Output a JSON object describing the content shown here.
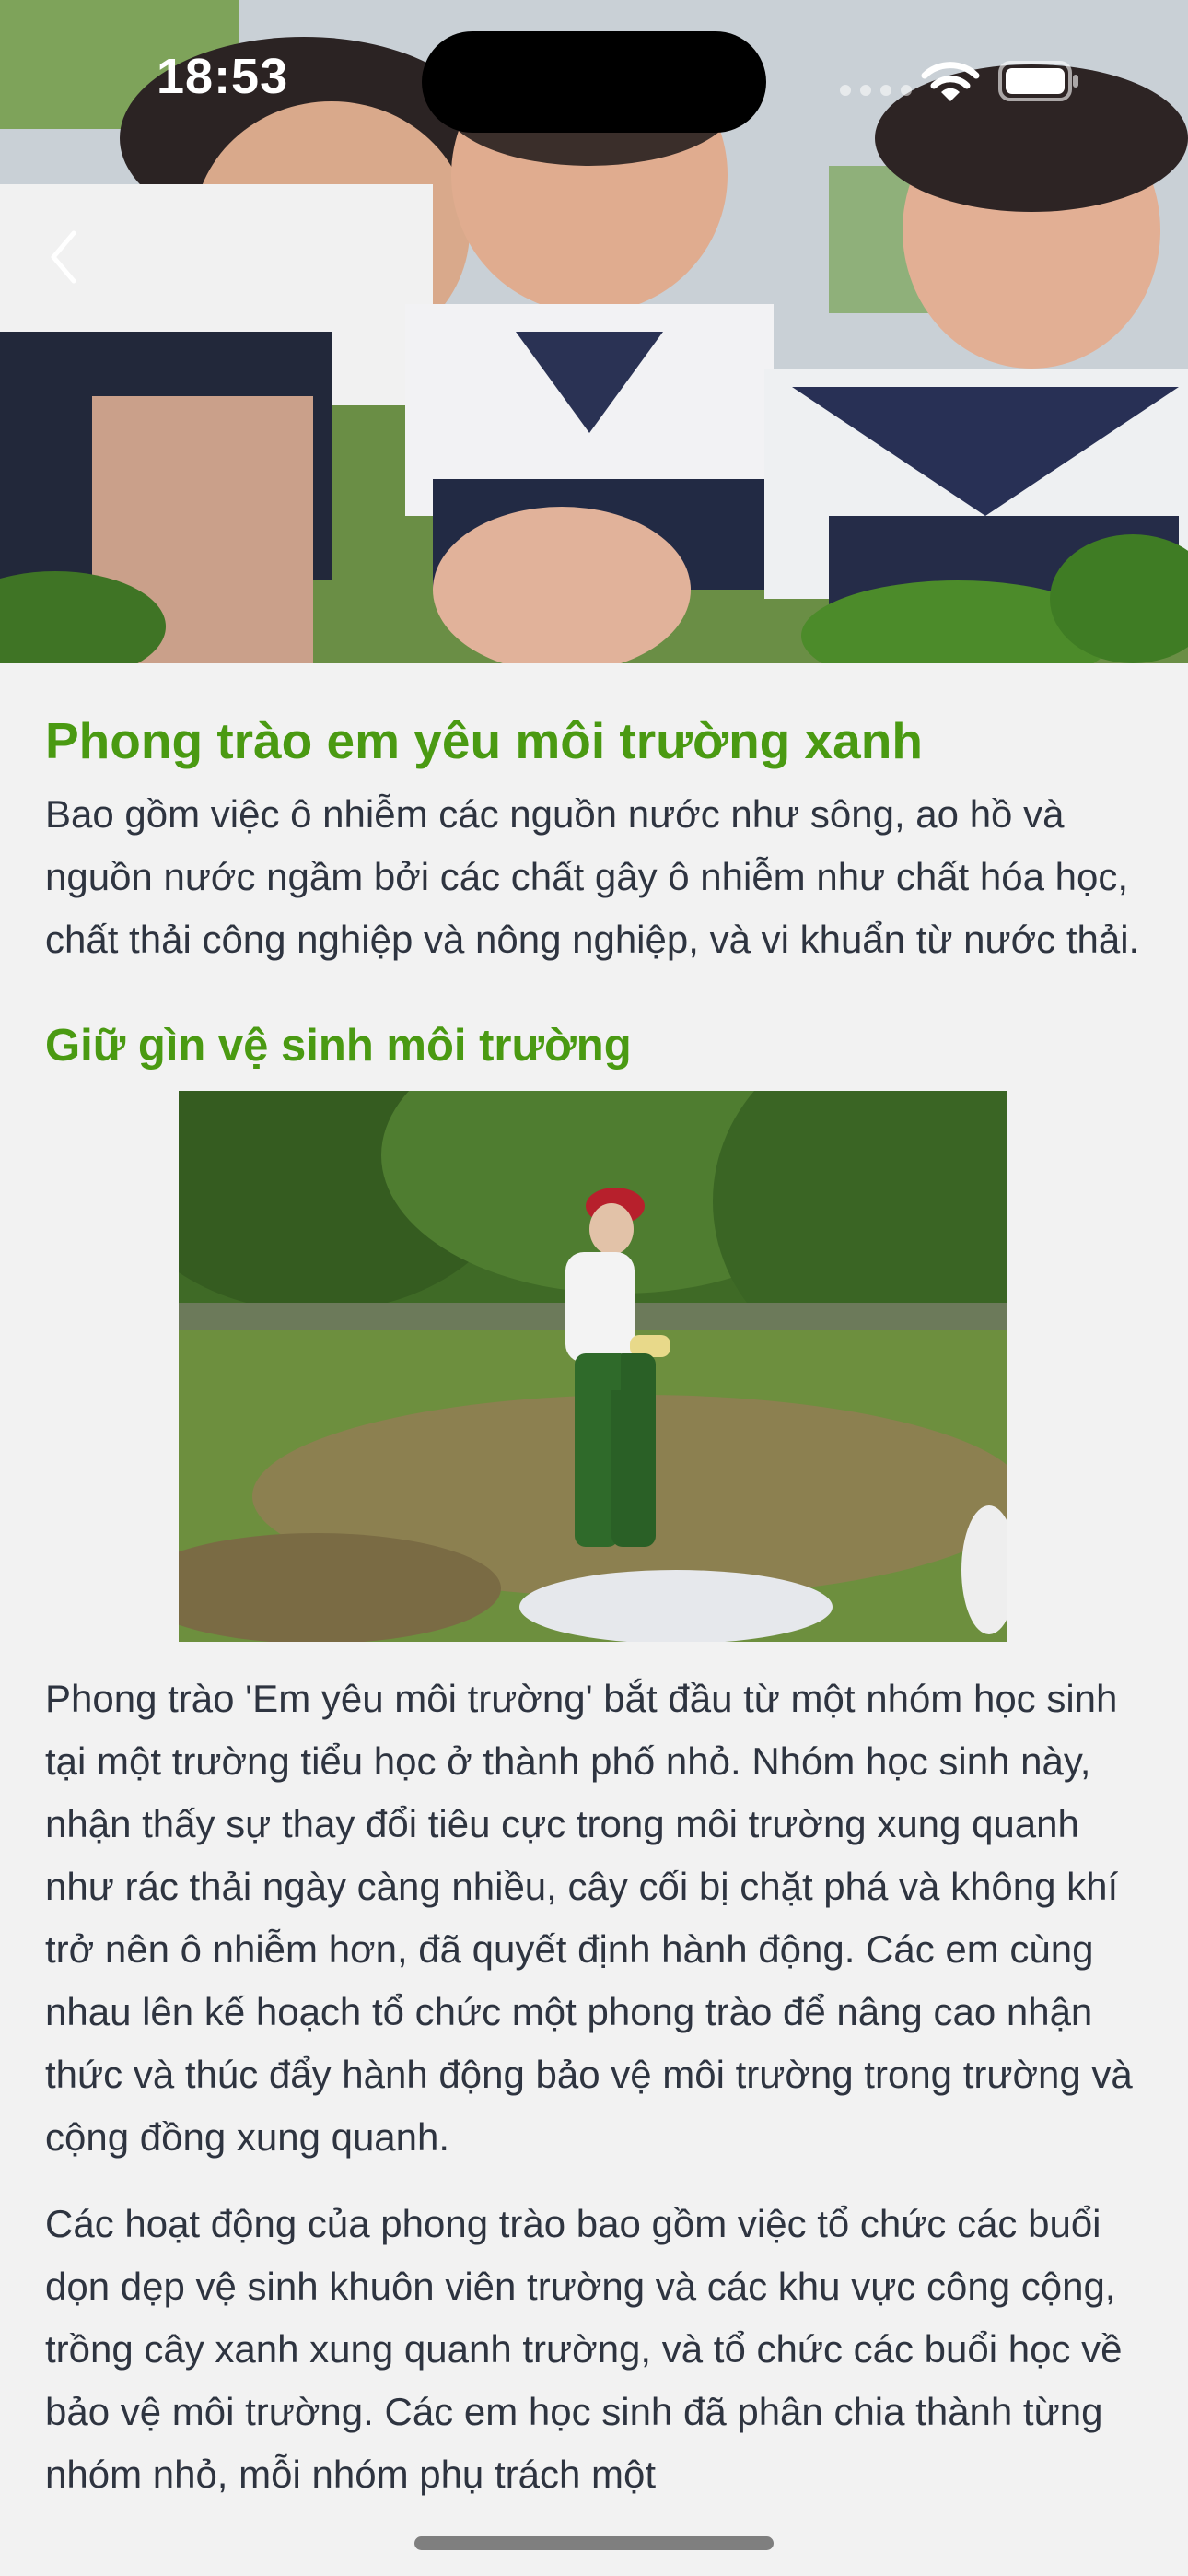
{
  "status_bar": {
    "time": "18:53"
  },
  "navigation": {
    "back_icon": "chevron-left-icon"
  },
  "article": {
    "title": "Phong trào em yêu môi trường xanh",
    "intro": "Bao gồm việc ô nhiễm các nguồn nước như sông, ao hồ và nguồn nước ngầm bởi các chất gây ô nhiễm như chất hóa học, chất thải công nghiệp và nông nghiệp, và vi khuẩn từ nước thải.",
    "subtitle": "Giữ gìn vệ sinh môi trường",
    "paragraph_1": "Phong trào 'Em yêu môi trường' bắt đầu từ một nhóm học sinh tại một trường tiểu học ở thành phố nhỏ. Nhóm học sinh này, nhận thấy sự thay đổi tiêu cực trong môi trường xung quanh như rác thải ngày càng nhiều, cây cối bị chặt phá và không khí trở nên ô nhiễm hơn, đã quyết định hành động. Các em cùng nhau lên kế hoạch tổ chức một phong trào để nâng cao nhận thức và thúc đẩy hành động bảo vệ môi trường trong trường và cộng đồng xung quanh.",
    "paragraph_2": "Các hoạt động của phong trào bao gồm việc tổ chức các buổi dọn dẹp vệ sinh khuôn viên trường và các khu vực công cộng, trồng cây xanh xung quanh trường, và tổ chức các buổi học về bảo vệ môi trường. Các em học sinh đã phân chia thành từng nhóm nhỏ, mỗi nhóm phụ trách một"
  },
  "colors": {
    "accent_green": "#4a9a12",
    "body_text": "#2e3440",
    "background": "#f2f2f2"
  }
}
